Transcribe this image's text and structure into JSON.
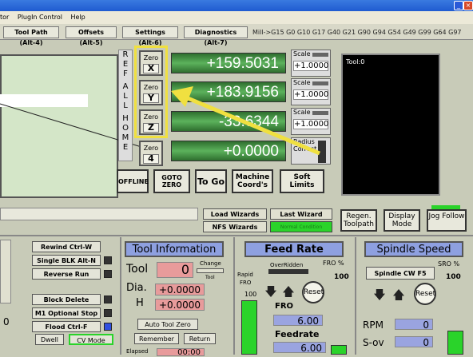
{
  "menu": {
    "items": [
      "tor",
      "PlugIn Control",
      "Help"
    ]
  },
  "tabs": [
    "Tool Path (Alt-4)",
    "Offsets (Alt-5)",
    "Settings (Alt-6)",
    "Diagnostics (Alt-7)"
  ],
  "gcodes": "Mill->G15  G0 G10 G17 G40 G21 G90 G94 G54 G49 G99 G64 G97",
  "refall": [
    "R",
    "E",
    "F",
    "A",
    "L",
    "L",
    "H",
    "O",
    "M",
    "E"
  ],
  "axes": [
    {
      "zero_line1": "Zero",
      "zero_axis": "X",
      "value": "+159.5031",
      "scale_label": "Scale",
      "scale": "+1.0000"
    },
    {
      "zero_line1": "Zero",
      "zero_axis": "Y",
      "value": "+183.9156",
      "scale_label": "Scale",
      "scale": "+1.0000"
    },
    {
      "zero_line1": "Zero",
      "zero_axis": "Z",
      "value": "-33.6344",
      "scale_label": "Scale",
      "scale": "+1.0000"
    },
    {
      "zero_line1": "Zero",
      "zero_axis": "4",
      "value": "+0.0000",
      "scale_label": "Radius Correct",
      "scale": ""
    }
  ],
  "buttons": {
    "offline": "OFFLINE",
    "goto_zero": "GOTO ZERO",
    "to_go": "To Go",
    "machine_coords": "Machine Coord's",
    "soft_limits": "Soft Limits",
    "load_wizards": "Load Wizards",
    "last_wizard": "Last Wizard",
    "nfs_wizards": "NFS Wizards",
    "normal_condition": "Normal Condition",
    "regen_toolpath": "Regen. Toolpath",
    "display_mode": "Display Mode",
    "jog_follow": "Jog Follow"
  },
  "toolpath": {
    "label": "Tool:0"
  },
  "left_controls": {
    "rewind": "Rewind Ctrl-W",
    "single_blk": "Single BLK Alt-N",
    "reverse_run": "Reverse Run",
    "block_delete": "Block Delete",
    "m1_optional": "M1 Optional Stop",
    "flood": "Flood Ctrl-F",
    "dwell": "Dwell",
    "cv_mode": "CV Mode",
    "zero_digit": "0"
  },
  "tool_info": {
    "title": "Tool Information",
    "tool_label": "Tool",
    "tool_value": "0",
    "change_label": "Change",
    "tool_small": "Tool",
    "dia_label": "Dia.",
    "dia_value": "+0.0000",
    "h_label": "H",
    "h_value": "+0.0000",
    "auto_zero": "Auto Tool Zero",
    "remember": "Remember",
    "return": "Return",
    "elapsed": "Elapsed",
    "elapsed_value": "00:00"
  },
  "feed": {
    "title": "Feed Rate",
    "overridden": "OverRidden",
    "fro_pct": "FRO %",
    "fro_value": "100",
    "rapid": "Rapid",
    "fro": "FRO",
    "rapid_value": "100",
    "reset": "Reset",
    "fro_label": "FRO",
    "fro_field": "6.00",
    "feedrate_label": "Feedrate",
    "feedrate_field": "6.00"
  },
  "spindle": {
    "title": "Spindle Speed",
    "sro_pct": "SRO %",
    "sro_value": "100",
    "cw": "Spindle CW F5",
    "reset": "Reset",
    "rpm_label": "RPM",
    "rpm_value": "0",
    "sov_label": "S-ov",
    "sov_value": "0"
  },
  "colors": {
    "annotation": "#f0e040",
    "dro_green": "#4ca84c"
  }
}
